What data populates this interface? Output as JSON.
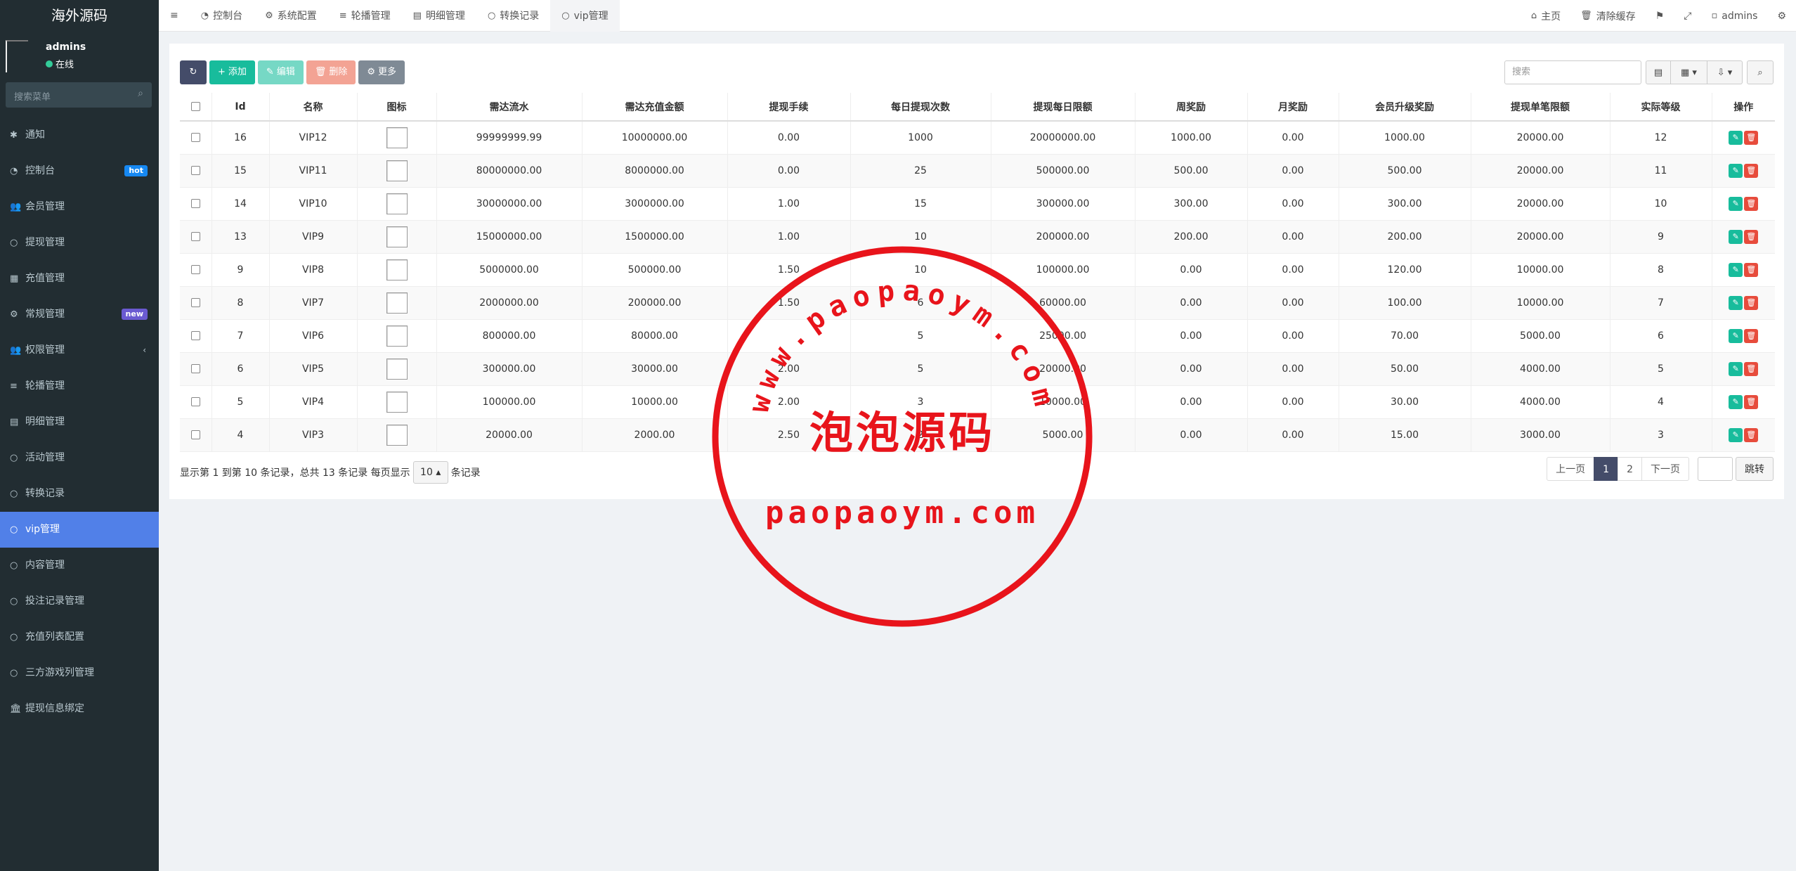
{
  "app": {
    "logo": "海外源码"
  },
  "user": {
    "name": "admins",
    "status": "在线"
  },
  "sidebar": {
    "search_placeholder": "搜索菜单",
    "items": [
      {
        "label": "通知",
        "icon": "✱"
      },
      {
        "label": "控制台",
        "icon": "◔",
        "badge": "hot"
      },
      {
        "label": "会员管理",
        "icon": "👥"
      },
      {
        "label": "提现管理",
        "icon": "○"
      },
      {
        "label": "充值管理",
        "icon": "▦"
      },
      {
        "label": "常规管理",
        "icon": "⚙",
        "badge": "new"
      },
      {
        "label": "权限管理",
        "icon": "👥"
      },
      {
        "label": "轮播管理",
        "icon": "≡"
      },
      {
        "label": "明细管理",
        "icon": "▤"
      },
      {
        "label": "活动管理",
        "icon": "○"
      },
      {
        "label": "转换记录",
        "icon": "○"
      },
      {
        "label": "vip管理",
        "icon": "○"
      },
      {
        "label": "内容管理",
        "icon": "○"
      },
      {
        "label": "投注记录管理",
        "icon": "○"
      },
      {
        "label": "充值列表配置",
        "icon": "○"
      },
      {
        "label": "三方游戏列管理",
        "icon": "○"
      },
      {
        "label": "提现信息绑定",
        "icon": "🏛"
      }
    ]
  },
  "topbar": {
    "tabs": [
      {
        "label": "控制台",
        "icon": "◔"
      },
      {
        "label": "系统配置",
        "icon": "⚙"
      },
      {
        "label": "轮播管理",
        "icon": "≡"
      },
      {
        "label": "明细管理",
        "icon": "▤"
      },
      {
        "label": "转换记录",
        "icon": "○"
      },
      {
        "label": "vip管理",
        "icon": "○"
      }
    ],
    "home": "主页",
    "clear_cache": "清除缓存",
    "admin": "admins"
  },
  "toolbar": {
    "add": "添加",
    "edit": "编辑",
    "delete": "删除",
    "more": "更多",
    "search_placeholder": "搜索"
  },
  "table": {
    "headers": [
      "Id",
      "名称",
      "图标",
      "需达流水",
      "需达充值金额",
      "提现手续",
      "每日提现次数",
      "提现每日限额",
      "周奖励",
      "月奖励",
      "会员升级奖励",
      "提现单笔限额",
      "实际等级",
      "操作"
    ],
    "rows": [
      [
        "16",
        "VIP12",
        "99999999.99",
        "10000000.00",
        "0.00",
        "1000",
        "20000000.00",
        "1000.00",
        "0.00",
        "1000.00",
        "20000.00",
        "12"
      ],
      [
        "15",
        "VIP11",
        "80000000.00",
        "8000000.00",
        "0.00",
        "25",
        "500000.00",
        "500.00",
        "0.00",
        "500.00",
        "20000.00",
        "11"
      ],
      [
        "14",
        "VIP10",
        "30000000.00",
        "3000000.00",
        "1.00",
        "15",
        "300000.00",
        "300.00",
        "0.00",
        "300.00",
        "20000.00",
        "10"
      ],
      [
        "13",
        "VIP9",
        "15000000.00",
        "1500000.00",
        "1.00",
        "10",
        "200000.00",
        "200.00",
        "0.00",
        "200.00",
        "20000.00",
        "9"
      ],
      [
        "9",
        "VIP8",
        "5000000.00",
        "500000.00",
        "1.50",
        "10",
        "100000.00",
        "0.00",
        "0.00",
        "120.00",
        "10000.00",
        "8"
      ],
      [
        "8",
        "VIP7",
        "2000000.00",
        "200000.00",
        "1.50",
        "6",
        "60000.00",
        "0.00",
        "0.00",
        "100.00",
        "10000.00",
        "7"
      ],
      [
        "7",
        "VIP6",
        "800000.00",
        "80000.00",
        "",
        "5",
        "25000.00",
        "0.00",
        "0.00",
        "70.00",
        "5000.00",
        "6"
      ],
      [
        "6",
        "VIP5",
        "300000.00",
        "30000.00",
        "2.00",
        "5",
        "20000.00",
        "0.00",
        "0.00",
        "50.00",
        "4000.00",
        "5"
      ],
      [
        "5",
        "VIP4",
        "100000.00",
        "10000.00",
        "2.00",
        "3",
        "10000.00",
        "0.00",
        "0.00",
        "30.00",
        "4000.00",
        "4"
      ],
      [
        "4",
        "VIP3",
        "20000.00",
        "2000.00",
        "2.50",
        "2",
        "5000.00",
        "0.00",
        "0.00",
        "15.00",
        "3000.00",
        "3"
      ]
    ]
  },
  "pagination": {
    "info_prefix": "显示第 1 到第 10 条记录，总共 13 条记录 每页显示",
    "page_size": "10",
    "info_suffix": "条记录",
    "prev": "上一页",
    "pages": [
      "1",
      "2"
    ],
    "next": "下一页",
    "jump": "跳转"
  },
  "watermark": {
    "arc_text": "www.paopaoym.com",
    "center_text": "泡泡源码",
    "bottom_text": "paopaoym.com",
    "color": "#e8141b"
  }
}
